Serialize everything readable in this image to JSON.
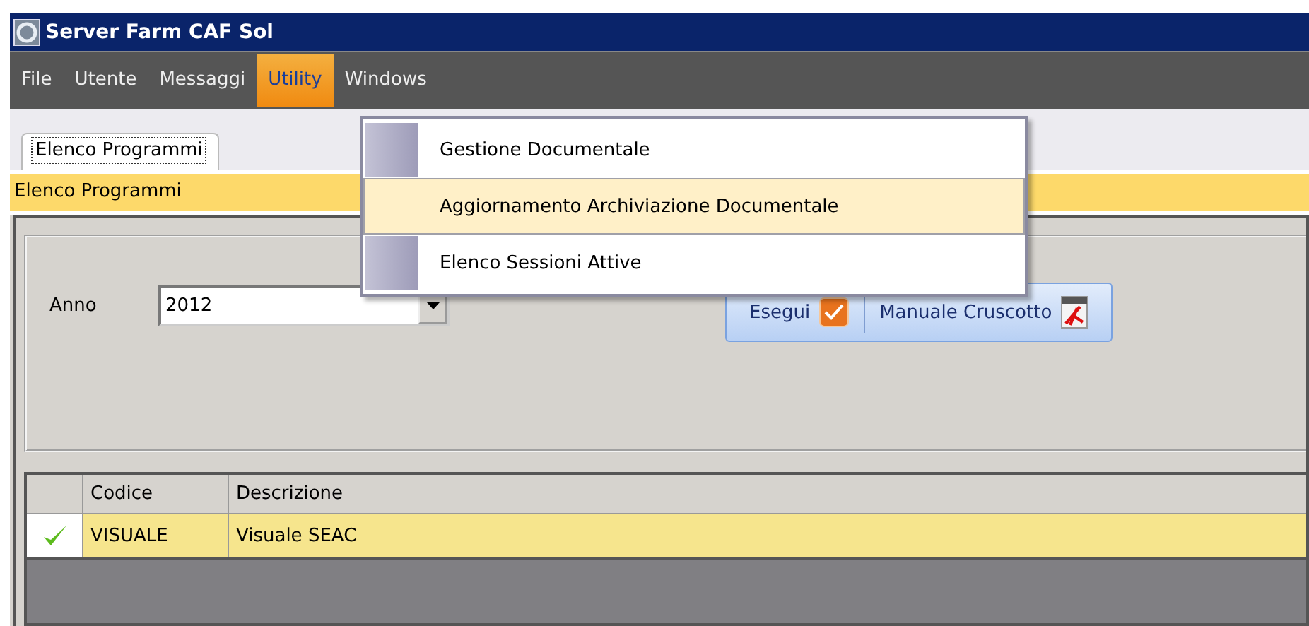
{
  "window": {
    "title": "Server Farm CAF Sol"
  },
  "menu_bar": [
    {
      "label": "File",
      "selected": false
    },
    {
      "label": "Utente",
      "selected": false
    },
    {
      "label": "Messaggi",
      "selected": false
    },
    {
      "label": "Utility",
      "selected": true
    },
    {
      "label": "Windows",
      "selected": false
    }
  ],
  "open_menu": {
    "items": [
      {
        "label": "Gestione Documentale",
        "selected": false
      },
      {
        "label": "Aggiornamento Archiviazione Documentale",
        "selected": true
      },
      {
        "label": "Elenco Sessioni Attive",
        "selected": false
      }
    ]
  },
  "tabs": [
    {
      "label": "Elenco Programmi",
      "selected": true
    }
  ],
  "section_title": "Elenco Programmi",
  "filter": {
    "label": "Anno",
    "value": "2012"
  },
  "buttons": [
    {
      "label": "Esegui",
      "kind": "run"
    },
    {
      "label": "Manuale Cruscotto",
      "kind": "pdf"
    }
  ],
  "table": {
    "columns": [
      "Codice",
      "Descrizione"
    ],
    "rows": [
      {
        "checked": true,
        "selected": true,
        "cells": [
          "VISUALE",
          "Visuale SEAC"
        ]
      }
    ]
  }
}
